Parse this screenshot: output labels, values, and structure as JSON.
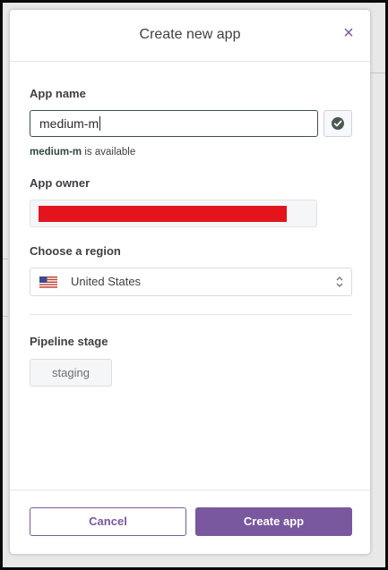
{
  "modal": {
    "title": "Create new app",
    "close_glyph": "×"
  },
  "app_name": {
    "label": "App name",
    "value": "medium-m",
    "status_icon": "check-circle-icon",
    "availability_name": "medium-m",
    "availability_text": " is available"
  },
  "app_owner": {
    "label": "App owner",
    "redacted": true
  },
  "region": {
    "label": "Choose a region",
    "flag_icon": "us-flag-icon",
    "selected": "United States",
    "arrow_icon": "updown-chevron-icon"
  },
  "pipeline": {
    "label": "Pipeline stage",
    "stage": "staging"
  },
  "footer": {
    "cancel_label": "Cancel",
    "create_label": "Create app"
  },
  "colors": {
    "accent": "#79589f",
    "redaction": "#e3141c",
    "input_border": "#3f4f4a",
    "check_icon": "#4a5a52"
  }
}
